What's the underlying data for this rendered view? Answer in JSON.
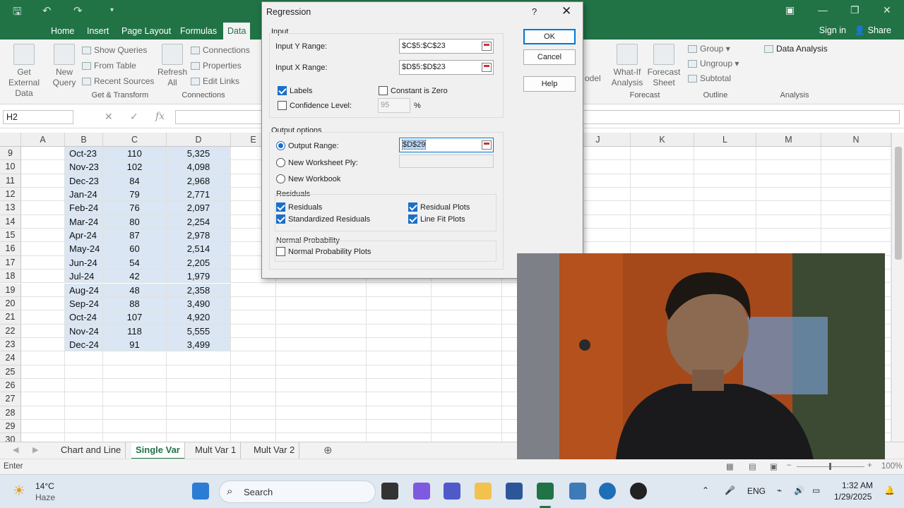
{
  "ribbon_tabs": [
    "Home",
    "Insert",
    "Page Layout",
    "Formulas",
    "Data"
  ],
  "header": {
    "signin": "Sign in",
    "share": "Share"
  },
  "ribbon": {
    "get_external": [
      "Get External",
      "Data"
    ],
    "new_query": [
      "New",
      "Query"
    ],
    "show_queries": "Show Queries",
    "from_table": "From Table",
    "recent_sources": "Recent Sources",
    "group_get_transform": "Get & Transform",
    "refresh": [
      "Refresh",
      "All"
    ],
    "connections": "Connections",
    "properties": "Properties",
    "edit_links": "Edit Links",
    "group_connections": "Connections",
    "model_partial": "odel",
    "what_if": [
      "What-If",
      "Analysis"
    ],
    "forecast_sheet": [
      "Forecast",
      "Sheet"
    ],
    "group_forecast": "Forecast",
    "group": "Group",
    "ungroup": "Ungroup",
    "subtotal": "Subtotal",
    "group_outline": "Outline",
    "data_analysis": "Data Analysis",
    "group_analysis": "Analysis"
  },
  "formula_bar": {
    "namebox": "H2",
    "fx": "fx",
    "value": ""
  },
  "columns": [
    "A",
    "B",
    "C",
    "D",
    "E",
    "J",
    "K",
    "L",
    "M",
    "N"
  ],
  "rows": [
    {
      "n": "9",
      "b": "Oct-23",
      "c": "110",
      "d": "5,325"
    },
    {
      "n": "10",
      "b": "Nov-23",
      "c": "102",
      "d": "4,098"
    },
    {
      "n": "11",
      "b": "Dec-23",
      "c": "84",
      "d": "2,968"
    },
    {
      "n": "12",
      "b": "Jan-24",
      "c": "79",
      "d": "2,771"
    },
    {
      "n": "13",
      "b": "Feb-24",
      "c": "76",
      "d": "2,097"
    },
    {
      "n": "14",
      "b": "Mar-24",
      "c": "80",
      "d": "2,254"
    },
    {
      "n": "15",
      "b": "Apr-24",
      "c": "87",
      "d": "2,978"
    },
    {
      "n": "16",
      "b": "May-24",
      "c": "60",
      "d": "2,514"
    },
    {
      "n": "17",
      "b": "Jun-24",
      "c": "54",
      "d": "2,205"
    },
    {
      "n": "18",
      "b": "Jul-24",
      "c": "42",
      "d": "1,979"
    },
    {
      "n": "19",
      "b": "Aug-24",
      "c": "48",
      "d": "2,358"
    },
    {
      "n": "20",
      "b": "Sep-24",
      "c": "88",
      "d": "3,490"
    },
    {
      "n": "21",
      "b": "Oct-24",
      "c": "107",
      "d": "4,920"
    },
    {
      "n": "22",
      "b": "Nov-24",
      "c": "118",
      "d": "5,555"
    },
    {
      "n": "23",
      "b": "Dec-24",
      "c": "91",
      "d": "3,499"
    },
    {
      "n": "24",
      "b": "",
      "c": "",
      "d": ""
    },
    {
      "n": "25",
      "b": "",
      "c": "",
      "d": ""
    },
    {
      "n": "26",
      "b": "",
      "c": "",
      "d": ""
    },
    {
      "n": "27",
      "b": "",
      "c": "",
      "d": ""
    },
    {
      "n": "28",
      "b": "",
      "c": "",
      "d": ""
    },
    {
      "n": "29",
      "b": "",
      "c": "",
      "d": ""
    },
    {
      "n": "30",
      "b": "",
      "c": "",
      "d": ""
    }
  ],
  "sheets": [
    "Chart and Line",
    "Single Var",
    "Mult Var 1",
    "Mult Var 2"
  ],
  "active_sheet": "Single Var",
  "status": {
    "mode": "Enter",
    "zoom": "100%"
  },
  "dialog": {
    "title": "Regression",
    "help_glyph": "?",
    "input_header": "Input",
    "input_y_label": "Input Y Range:",
    "input_y_value": "$C$5:$C$23",
    "input_x_label": "Input X Range:",
    "input_x_value": "$D$5:$D$23",
    "labels": "Labels",
    "labels_checked": true,
    "constant_zero": "Constant is Zero",
    "constant_zero_checked": false,
    "confidence": "Confidence Level:",
    "confidence_checked": false,
    "confidence_value": "95",
    "percent": "%",
    "output_header": "Output options",
    "output_range": "Output Range:",
    "output_range_value": "$D$29",
    "new_ply": "New Worksheet Ply:",
    "new_workbook": "New Workbook",
    "selected_output": "output_range",
    "residuals_header": "Residuals",
    "residuals": "Residuals",
    "std_residuals": "Standardized Residuals",
    "residual_plots": "Residual Plots",
    "line_fit_plots": "Line Fit Plots",
    "normal_header": "Normal Probability",
    "normal_plots": "Normal Probability Plots",
    "ok": "OK",
    "cancel": "Cancel",
    "help": "Help"
  },
  "taskbar": {
    "weather_temp": "14°C",
    "weather_desc": "Haze",
    "search": "Search",
    "lang": "ENG",
    "time": "1:32 AM",
    "date": "1/29/2025"
  },
  "colors": {
    "excel_green": "#217346",
    "selection": "#dae6f3",
    "accent_blue": "#1a6fc9"
  }
}
